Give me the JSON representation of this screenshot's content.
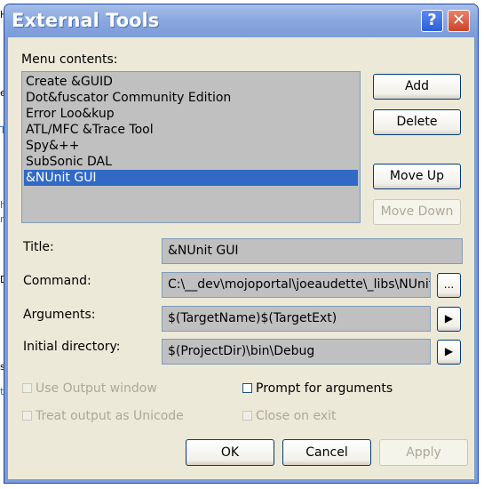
{
  "window": {
    "title": "External Tools"
  },
  "titlebar": {
    "help_glyph": "?",
    "close_glyph": "✕"
  },
  "background_app": {
    "fragments": [
      "H",
      "e",
      "T",
      "h",
      "r",
      "D",
      "s",
      "t"
    ]
  },
  "menu_contents": {
    "label": "Menu contents:",
    "items": [
      "Create &GUID",
      "Dot&fuscator Community Edition",
      "Error Loo&kup",
      "ATL/MFC &Trace Tool",
      "Spy&++",
      "SubSonic DAL",
      "&NUnit GUI"
    ],
    "selected_index": 6
  },
  "side_buttons": {
    "add": "Add",
    "delete": "Delete",
    "move_up": "Move Up",
    "move_down": "Move Down"
  },
  "fields": {
    "title": {
      "label": "Title:",
      "value": "&NUnit GUI"
    },
    "command": {
      "label": "Command:",
      "value": "C:\\__dev\\mojoportal\\joeaudette\\_libs\\NUnit",
      "browse": "..."
    },
    "arguments": {
      "label": "Arguments:",
      "value": "$(TargetName)$(TargetExt)",
      "arrow": "▶"
    },
    "initial_directory": {
      "label": "Initial directory:",
      "value": "$(ProjectDir)\\bin\\Debug",
      "arrow": "▶"
    }
  },
  "options": {
    "use_output_window": {
      "label": "Use Output window",
      "checked": false,
      "enabled": false
    },
    "prompt_for_arguments": {
      "label": "Prompt for arguments",
      "checked": false,
      "enabled": true
    },
    "treat_output_unicode": {
      "label": "Treat output as Unicode",
      "checked": false,
      "enabled": false
    },
    "close_on_exit": {
      "label": "Close on exit",
      "checked": false,
      "enabled": false
    }
  },
  "footer": {
    "ok": "OK",
    "cancel": "Cancel",
    "apply": "Apply"
  }
}
